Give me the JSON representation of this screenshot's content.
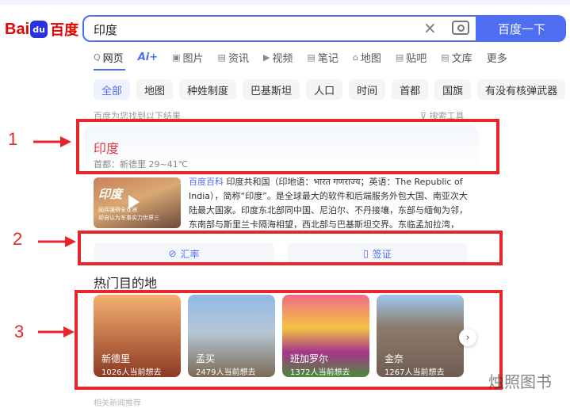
{
  "logo": {
    "bai": "Bai",
    "paw": "du",
    "cn": "百度"
  },
  "search": {
    "value": "印度",
    "clear_icon": "×",
    "button": "百度一下"
  },
  "nav": {
    "tabs": [
      {
        "icon": "Q",
        "label": "网页"
      },
      {
        "icon": "",
        "label": "Ai+"
      },
      {
        "icon": "▣",
        "label": "图片"
      },
      {
        "icon": "▤",
        "label": "资讯"
      },
      {
        "icon": "▶",
        "label": "视频"
      },
      {
        "icon": "▤",
        "label": "笔记"
      },
      {
        "icon": "⌂",
        "label": "地图"
      },
      {
        "icon": "▤",
        "label": "贴吧"
      },
      {
        "icon": "▤",
        "label": "文库"
      },
      {
        "icon": "",
        "label": "更多"
      }
    ]
  },
  "chips": [
    "全部",
    "地图",
    "种姓制度",
    "巴基斯坦",
    "人口",
    "时间",
    "首都",
    "国旗",
    "有没有核弹武器"
  ],
  "result_meta": {
    "found": "百度为您找到以下结果",
    "tools": "搜索工具"
  },
  "card": {
    "title": "印度",
    "subtitle": "首都：新德里   29~41℃",
    "thumb": {
      "title": "印度",
      "cap1": "闻兵强得全亚洲",
      "cap2": "却自认为军事实力世界三"
    },
    "desc_source": "百度百科",
    "desc_text": " 印度共和国（印地语：भारत गणराज्य；英语：The Republic of India），简称“印度”。是全球最大的软件和后端服务外包大国、南亚次大陆最大国家。印度东北部同中国、尼泊尔、不丹接壤，东部与缅甸为邻，东南部与斯里兰卡隔海相望，西北部与巴基斯坦交界。东临孟加拉湾，西...",
    "buttons": [
      {
        "label": "汇率"
      },
      {
        "label": "签证"
      }
    ],
    "hot_title": "热门目的地",
    "destinations": [
      {
        "name": "新德里",
        "count": "1026人当前想去"
      },
      {
        "name": "孟买",
        "count": "2479人当前想去"
      },
      {
        "name": "班加罗尔",
        "count": "1372人当前想去"
      },
      {
        "name": "金奈",
        "count": "1267人当前想去"
      }
    ]
  },
  "annotations": {
    "n1": "1",
    "n2": "2",
    "n3": "3"
  },
  "watermark": "烛照图书",
  "bottom": "相关新闻推荐"
}
